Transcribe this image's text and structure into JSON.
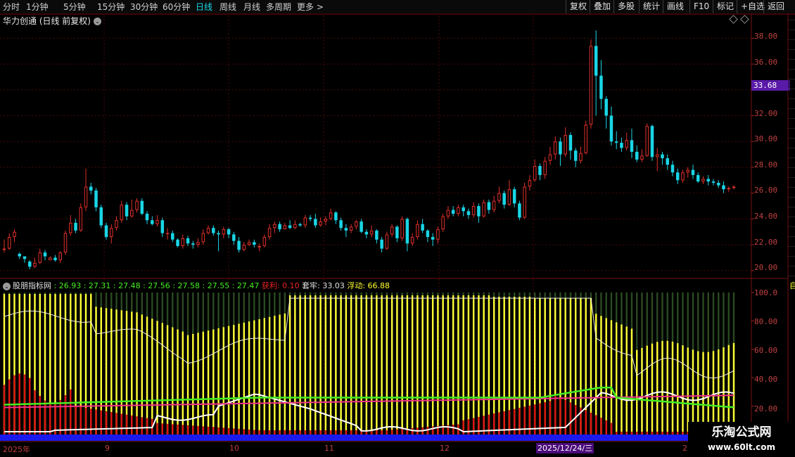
{
  "toolbar": {
    "periods": [
      "分时",
      "1分钟",
      "5分钟",
      "15分钟",
      "30分钟",
      "60分钟",
      "日线",
      "周线",
      "月线",
      "多周期",
      "更多 >"
    ],
    "active_index": 6,
    "right_buttons": [
      "复权",
      "叠加",
      "多股",
      "统计",
      "画线",
      "F10",
      "标记",
      "+自选",
      "返回"
    ]
  },
  "main_chart": {
    "title": "华力创通 (日线 前复权)",
    "y_ticks": [
      "38.00",
      "36.00",
      "34.00",
      "32.00",
      "30.00",
      "28.00",
      "26.00",
      "24.00",
      "22.00",
      "20.00"
    ],
    "current_price_tag": "33.68"
  },
  "indicator": {
    "name": "股朋指标网",
    "values": [
      ": 26.93",
      ": 27.31",
      ": 27.48",
      ": 27.56",
      ": 27.58",
      ": 27.55",
      ": 27.47"
    ],
    "profit_label": "获利: 0.10",
    "trapped_label": "套牢: 33.03",
    "float_label": "浮动: 66.88",
    "y_ticks": [
      "100.0",
      "80.00",
      "60.00",
      "40.00",
      "20.00"
    ],
    "right_col_first": "自"
  },
  "dates": {
    "labels": [
      "2025年",
      "9",
      "10",
      "11",
      "12",
      "2"
    ],
    "cursor_date": "2025/12/24/三"
  },
  "watermark": {
    "line1": "乐淘公式网",
    "line2": "www.60lt.com"
  },
  "colors": {
    "up": "#e0302a",
    "down": "#19d6e6",
    "tag": "#5a1aa8",
    "yellow": "#ffff33",
    "white": "#ffffff",
    "green": "#44ee22",
    "pink": "#ee3388",
    "blue": "#1a1aee"
  },
  "chart_data": {
    "type": "candlestick",
    "y_range": [
      19.5,
      39
    ],
    "candles": [
      [
        21.6,
        21.7,
        22.4,
        21.4
      ],
      [
        21.7,
        22.6,
        22.9,
        21.6
      ],
      [
        22.6,
        23.0,
        23.2,
        22.2
      ],
      [
        21.3,
        21.1,
        21.4,
        20.9
      ],
      [
        21.1,
        20.9,
        21.1,
        20.6
      ],
      [
        20.7,
        20.3,
        20.8,
        20.1
      ],
      [
        20.3,
        20.6,
        21.0,
        20.2
      ],
      [
        20.6,
        21.4,
        21.7,
        20.5
      ],
      [
        21.4,
        21.1,
        21.6,
        20.8
      ],
      [
        20.8,
        21.0,
        21.1,
        20.8
      ],
      [
        21.0,
        20.8,
        21.2,
        20.7
      ],
      [
        20.8,
        21.4,
        21.5,
        20.6
      ],
      [
        21.4,
        22.9,
        23.1,
        21.2
      ],
      [
        22.9,
        23.7,
        24.3,
        22.7
      ],
      [
        23.7,
        23.1,
        24.0,
        22.9
      ],
      [
        23.1,
        24.9,
        25.2,
        23.0
      ],
      [
        24.9,
        26.5,
        27.9,
        24.6
      ],
      [
        26.5,
        26.2,
        26.8,
        25.9
      ],
      [
        26.2,
        24.9,
        26.4,
        24.6
      ],
      [
        24.9,
        23.5,
        25.1,
        23.3
      ],
      [
        23.5,
        22.6,
        23.7,
        22.4
      ],
      [
        22.6,
        23.3,
        23.6,
        22.1
      ],
      [
        23.3,
        23.9,
        24.2,
        23.1
      ],
      [
        23.9,
        25.1,
        25.4,
        23.7
      ],
      [
        25.1,
        24.2,
        25.3,
        23.9
      ],
      [
        24.2,
        24.7,
        25.5,
        24.1
      ],
      [
        24.7,
        25.4,
        25.6,
        24.5
      ],
      [
        25.4,
        24.4,
        25.6,
        24.3
      ],
      [
        24.4,
        23.9,
        24.6,
        23.6
      ],
      [
        23.9,
        23.6,
        24.2,
        23.5
      ],
      [
        23.6,
        23.9,
        24.3,
        23.4
      ],
      [
        23.9,
        22.9,
        24.1,
        22.6
      ],
      [
        22.9,
        22.9,
        23.3,
        22.4
      ],
      [
        22.9,
        22.4,
        23.1,
        22.2
      ],
      [
        22.4,
        21.9,
        22.5,
        21.8
      ],
      [
        21.9,
        22.5,
        22.8,
        21.7
      ],
      [
        22.5,
        22.1,
        22.7,
        21.9
      ],
      [
        22.1,
        22.0,
        22.3,
        21.7
      ],
      [
        22.0,
        22.2,
        22.5,
        21.8
      ],
      [
        22.2,
        22.9,
        23.2,
        22.0
      ],
      [
        22.9,
        23.3,
        23.5,
        22.8
      ],
      [
        23.3,
        22.9,
        23.5,
        22.7
      ],
      [
        22.9,
        22.8,
        23.1,
        21.5
      ],
      [
        22.8,
        23.2,
        23.4,
        22.5
      ],
      [
        23.2,
        22.8,
        23.3,
        22.5
      ],
      [
        22.8,
        22.3,
        23.0,
        22.0
      ],
      [
        22.3,
        21.6,
        22.6,
        21.4
      ],
      [
        21.6,
        22.0,
        22.2,
        21.5
      ],
      [
        22.0,
        22.2,
        22.4,
        21.9
      ],
      [
        22.2,
        22.0,
        22.4,
        21.8
      ],
      [
        21.8,
        21.9,
        22.1,
        21.5
      ],
      [
        21.9,
        22.6,
        22.8,
        21.8
      ],
      [
        22.6,
        23.3,
        23.6,
        22.4
      ],
      [
        23.3,
        23.6,
        23.8,
        22.9
      ],
      [
        23.6,
        23.2,
        23.8,
        23.0
      ],
      [
        23.2,
        23.5,
        23.7,
        23.2
      ],
      [
        23.5,
        23.3,
        23.9,
        23.2
      ],
      [
        23.3,
        23.6,
        23.9,
        23.2
      ],
      [
        23.6,
        23.5,
        23.7,
        23.4
      ],
      [
        23.5,
        24.1,
        24.3,
        23.3
      ],
      [
        24.1,
        24.0,
        24.3,
        23.8
      ],
      [
        24.0,
        23.5,
        24.4,
        23.3
      ],
      [
        23.5,
        23.8,
        24.1,
        23.4
      ],
      [
        23.8,
        24.0,
        24.2,
        23.5
      ],
      [
        24.0,
        24.5,
        24.8,
        23.9
      ],
      [
        24.5,
        23.9,
        24.6,
        23.6
      ],
      [
        23.9,
        23.3,
        24.1,
        23.1
      ],
      [
        23.3,
        23.1,
        23.6,
        22.6
      ],
      [
        23.1,
        23.4,
        23.6,
        22.9
      ],
      [
        23.4,
        23.8,
        23.9,
        23.2
      ],
      [
        23.8,
        23.0,
        24.0,
        22.9
      ],
      [
        23.0,
        22.8,
        23.2,
        22.5
      ],
      [
        22.8,
        23.1,
        23.5,
        22.6
      ],
      [
        23.1,
        22.4,
        23.2,
        22.1
      ],
      [
        22.4,
        21.7,
        22.6,
        21.4
      ],
      [
        21.7,
        22.8,
        23.0,
        21.6
      ],
      [
        22.8,
        23.4,
        23.6,
        22.6
      ],
      [
        23.4,
        22.5,
        23.5,
        22.2
      ],
      [
        22.5,
        24.0,
        24.2,
        22.3
      ],
      [
        24.0,
        22.1,
        24.1,
        21.5
      ],
      [
        22.1,
        22.6,
        22.9,
        21.9
      ],
      [
        22.6,
        23.6,
        23.9,
        22.4
      ],
      [
        23.6,
        23.1,
        24.0,
        22.9
      ],
      [
        23.1,
        22.6,
        23.2,
        22.2
      ],
      [
        22.6,
        22.4,
        22.9,
        21.9
      ],
      [
        22.4,
        23.2,
        23.4,
        22.1
      ],
      [
        23.2,
        24.2,
        24.4,
        23.0
      ],
      [
        24.2,
        24.7,
        25.0,
        24.0
      ],
      [
        24.7,
        24.4,
        25.0,
        24.2
      ],
      [
        24.4,
        24.9,
        25.1,
        24.2
      ],
      [
        24.9,
        24.6,
        25.1,
        24.2
      ],
      [
        24.6,
        24.3,
        24.8,
        24.0
      ],
      [
        24.3,
        25.0,
        25.3,
        24.1
      ],
      [
        25.0,
        24.2,
        25.2,
        23.7
      ],
      [
        24.2,
        25.3,
        25.5,
        24.1
      ],
      [
        25.3,
        24.7,
        25.5,
        24.4
      ],
      [
        24.7,
        25.4,
        25.8,
        24.5
      ],
      [
        25.4,
        26.0,
        26.5,
        25.2
      ],
      [
        26.0,
        25.1,
        26.2,
        24.8
      ],
      [
        25.1,
        26.3,
        27.0,
        25.0
      ],
      [
        26.3,
        25.2,
        26.5,
        24.9
      ],
      [
        25.2,
        24.1,
        25.4,
        23.9
      ],
      [
        24.1,
        26.5,
        26.8,
        24.0
      ],
      [
        26.5,
        27.0,
        27.4,
        26.2
      ],
      [
        27.0,
        28.1,
        28.6,
        26.9
      ],
      [
        28.1,
        27.4,
        28.3,
        27.0
      ],
      [
        27.4,
        28.5,
        28.8,
        27.1
      ],
      [
        28.5,
        29.0,
        29.6,
        28.2
      ],
      [
        29.0,
        30.0,
        30.4,
        28.6
      ],
      [
        30.0,
        29.0,
        30.3,
        28.1
      ],
      [
        29.0,
        30.5,
        31.1,
        28.8
      ],
      [
        30.5,
        29.3,
        30.7,
        28.6
      ],
      [
        29.3,
        28.5,
        29.5,
        28.0
      ],
      [
        28.5,
        29.1,
        29.6,
        28.3
      ],
      [
        29.1,
        31.3,
        31.6,
        29.0
      ],
      [
        31.3,
        37.4,
        37.9,
        31.0
      ],
      [
        37.4,
        35.1,
        38.6,
        32.0
      ],
      [
        35.1,
        33.3,
        36.3,
        32.5
      ],
      [
        33.3,
        32.0,
        33.5,
        31.0
      ],
      [
        32.0,
        30.0,
        32.7,
        29.7
      ],
      [
        30.0,
        29.9,
        30.8,
        29.4
      ],
      [
        29.9,
        29.5,
        30.3,
        29.2
      ],
      [
        29.5,
        30.1,
        30.7,
        29.3
      ],
      [
        30.1,
        29.2,
        31.0,
        28.7
      ],
      [
        29.2,
        28.6,
        29.7,
        28.4
      ],
      [
        28.6,
        28.9,
        29.4,
        28.4
      ],
      [
        28.9,
        31.2,
        31.4,
        28.8
      ],
      [
        31.2,
        28.8,
        31.3,
        28.5
      ],
      [
        28.8,
        29.0,
        29.5,
        27.7
      ],
      [
        29.0,
        28.7,
        29.2,
        28.2
      ],
      [
        28.7,
        28.2,
        29.0,
        27.8
      ],
      [
        28.2,
        27.6,
        28.5,
        27.3
      ],
      [
        27.6,
        27.0,
        27.9,
        26.7
      ],
      [
        27.0,
        27.6,
        27.8,
        26.8
      ],
      [
        27.6,
        27.8,
        28.0,
        27.2
      ],
      [
        27.8,
        27.4,
        28.2,
        27.1
      ],
      [
        27.4,
        26.9,
        27.6,
        26.8
      ],
      [
        26.9,
        27.1,
        27.3,
        26.7
      ],
      [
        27.1,
        26.9,
        27.4,
        26.6
      ],
      [
        26.9,
        26.8,
        27.1,
        26.6
      ],
      [
        26.8,
        26.6,
        27.0,
        26.4
      ],
      [
        26.6,
        26.3,
        26.9,
        26.0
      ],
      [
        26.3,
        26.4,
        26.5,
        26.1
      ],
      [
        26.4,
        26.5,
        26.6,
        26.3
      ]
    ]
  }
}
